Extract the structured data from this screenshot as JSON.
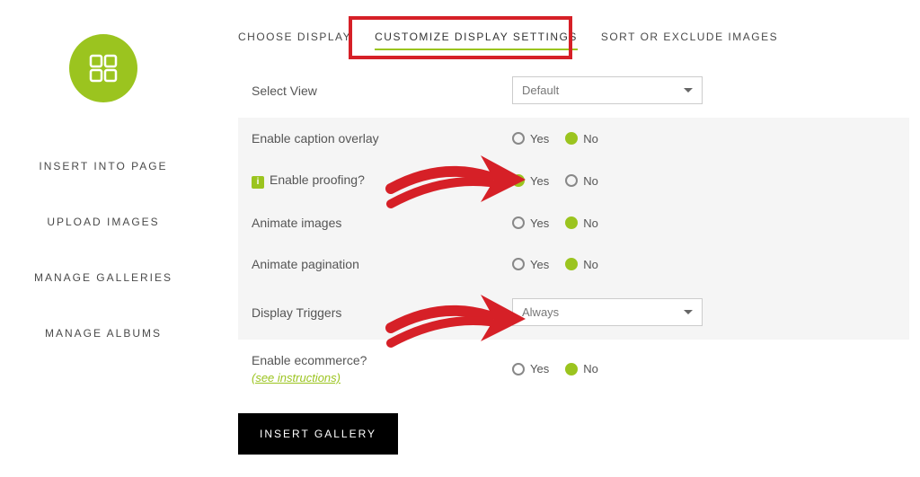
{
  "sidebar": {
    "items": [
      {
        "label": "INSERT INTO PAGE"
      },
      {
        "label": "UPLOAD IMAGES"
      },
      {
        "label": "MANAGE GALLERIES"
      },
      {
        "label": "MANAGE ALBUMS"
      }
    ]
  },
  "tabs": {
    "items": [
      {
        "label": "CHOOSE DISPLAY"
      },
      {
        "label": "CUSTOMIZE DISPLAY SETTINGS"
      },
      {
        "label": "SORT OR EXCLUDE IMAGES"
      }
    ],
    "active_index": 1
  },
  "settings": {
    "select_view": {
      "label": "Select View",
      "value": "Default"
    },
    "caption_overlay": {
      "label": "Enable caption overlay",
      "yes": "Yes",
      "no": "No",
      "value": "No"
    },
    "proofing": {
      "label": "Enable proofing?",
      "yes": "Yes",
      "no": "No",
      "value": "Yes"
    },
    "animate_images": {
      "label": "Animate images",
      "yes": "Yes",
      "no": "No",
      "value": "No"
    },
    "animate_pagination": {
      "label": "Animate pagination",
      "yes": "Yes",
      "no": "No",
      "value": "No"
    },
    "display_triggers": {
      "label": "Display Triggers",
      "value": "Always"
    },
    "ecommerce": {
      "label": "Enable ecommerce?",
      "instructions": "(see instructions)",
      "yes": "Yes",
      "no": "No",
      "value": "No"
    }
  },
  "insert_button": "INSERT GALLERY",
  "colors": {
    "accent": "#9bc41f",
    "annotation": "#d62027"
  }
}
